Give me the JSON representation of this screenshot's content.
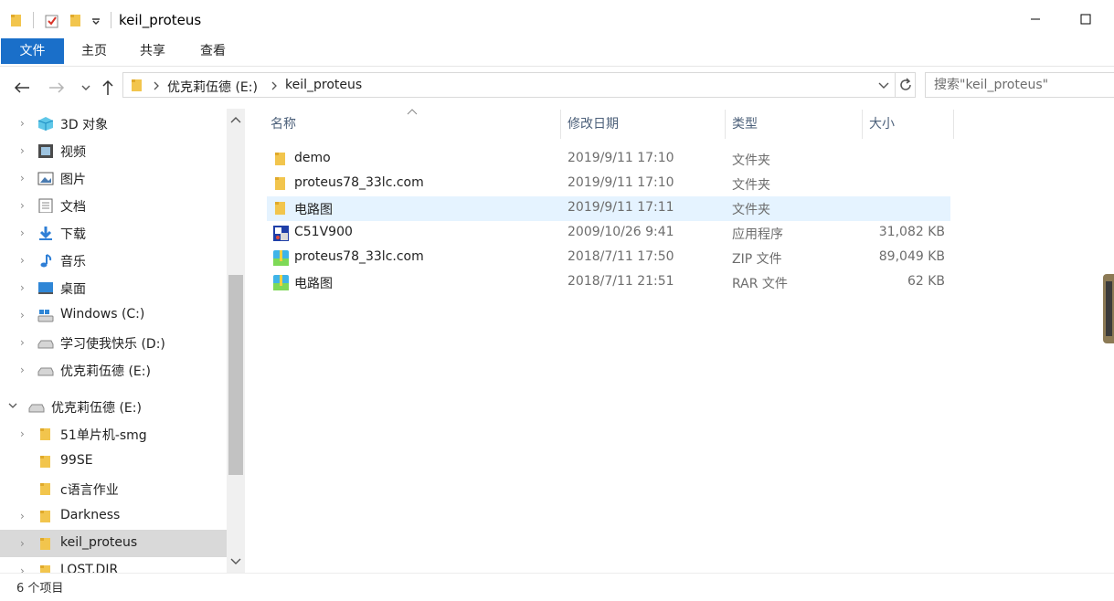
{
  "window": {
    "title": "keil_proteus"
  },
  "ribbon": {
    "tabs": [
      {
        "label": "文件",
        "active": true
      },
      {
        "label": "主页",
        "active": false
      },
      {
        "label": "共享",
        "active": false
      },
      {
        "label": "查看",
        "active": false
      }
    ]
  },
  "address": {
    "crumbs": [
      "优克莉伍德 (E:)",
      "keil_proteus"
    ],
    "search_placeholder": "搜索\"keil_proteus\""
  },
  "nav": {
    "items": [
      {
        "label": "3D 对象",
        "icon": "3d-objects-icon"
      },
      {
        "label": "视频",
        "icon": "video-icon"
      },
      {
        "label": "图片",
        "icon": "pictures-icon"
      },
      {
        "label": "文档",
        "icon": "documents-icon"
      },
      {
        "label": "下载",
        "icon": "download-icon"
      },
      {
        "label": "音乐",
        "icon": "music-icon"
      },
      {
        "label": "桌面",
        "icon": "desktop-icon"
      },
      {
        "label": "Windows (C:)",
        "icon": "drive-icon"
      },
      {
        "label": "学习使我快乐 (D:)",
        "icon": "drive-icon"
      },
      {
        "label": "优克莉伍德 (E:)",
        "icon": "drive-icon"
      },
      {
        "label": "优克莉伍德 (E:)",
        "icon": "drive-icon",
        "expanded": true
      },
      {
        "label": "51单片机-smg",
        "icon": "folder-icon"
      },
      {
        "label": "99SE",
        "icon": "folder-icon"
      },
      {
        "label": "c语言作业",
        "icon": "folder-icon"
      },
      {
        "label": "Darkness",
        "icon": "folder-icon"
      },
      {
        "label": "keil_proteus",
        "icon": "folder-icon",
        "selected": true
      },
      {
        "label": "LOST.DIR",
        "icon": "folder-icon"
      }
    ]
  },
  "columns": {
    "name": "名称",
    "date": "修改日期",
    "type": "类型",
    "size": "大小"
  },
  "files": [
    {
      "name": "demo",
      "date": "2019/9/11 17:10",
      "type": "文件夹",
      "size": "",
      "icon": "folder-icon"
    },
    {
      "name": "proteus78_33lc.com",
      "date": "2019/9/11 17:10",
      "type": "文件夹",
      "size": "",
      "icon": "folder-icon"
    },
    {
      "name": "电路图",
      "date": "2019/9/11 17:11",
      "type": "文件夹",
      "size": "",
      "icon": "folder-icon",
      "highlighted": true
    },
    {
      "name": "C51V900",
      "date": "2009/10/26 9:41",
      "type": "应用程序",
      "size": "31,082 KB",
      "icon": "application-icon"
    },
    {
      "name": "proteus78_33lc.com",
      "date": "2018/7/11 17:50",
      "type": "ZIP 文件",
      "size": "89,049 KB",
      "icon": "zip-icon"
    },
    {
      "name": "电路图",
      "date": "2018/7/11 21:51",
      "type": "RAR 文件",
      "size": "62 KB",
      "icon": "rar-icon"
    }
  ],
  "status": {
    "text": "6 个项目"
  },
  "colors": {
    "accent": "#1a6fc9",
    "selected_nav": "#d9d9d9",
    "highlight_row": "#e5f3ff",
    "folder": "#f2c54d"
  }
}
